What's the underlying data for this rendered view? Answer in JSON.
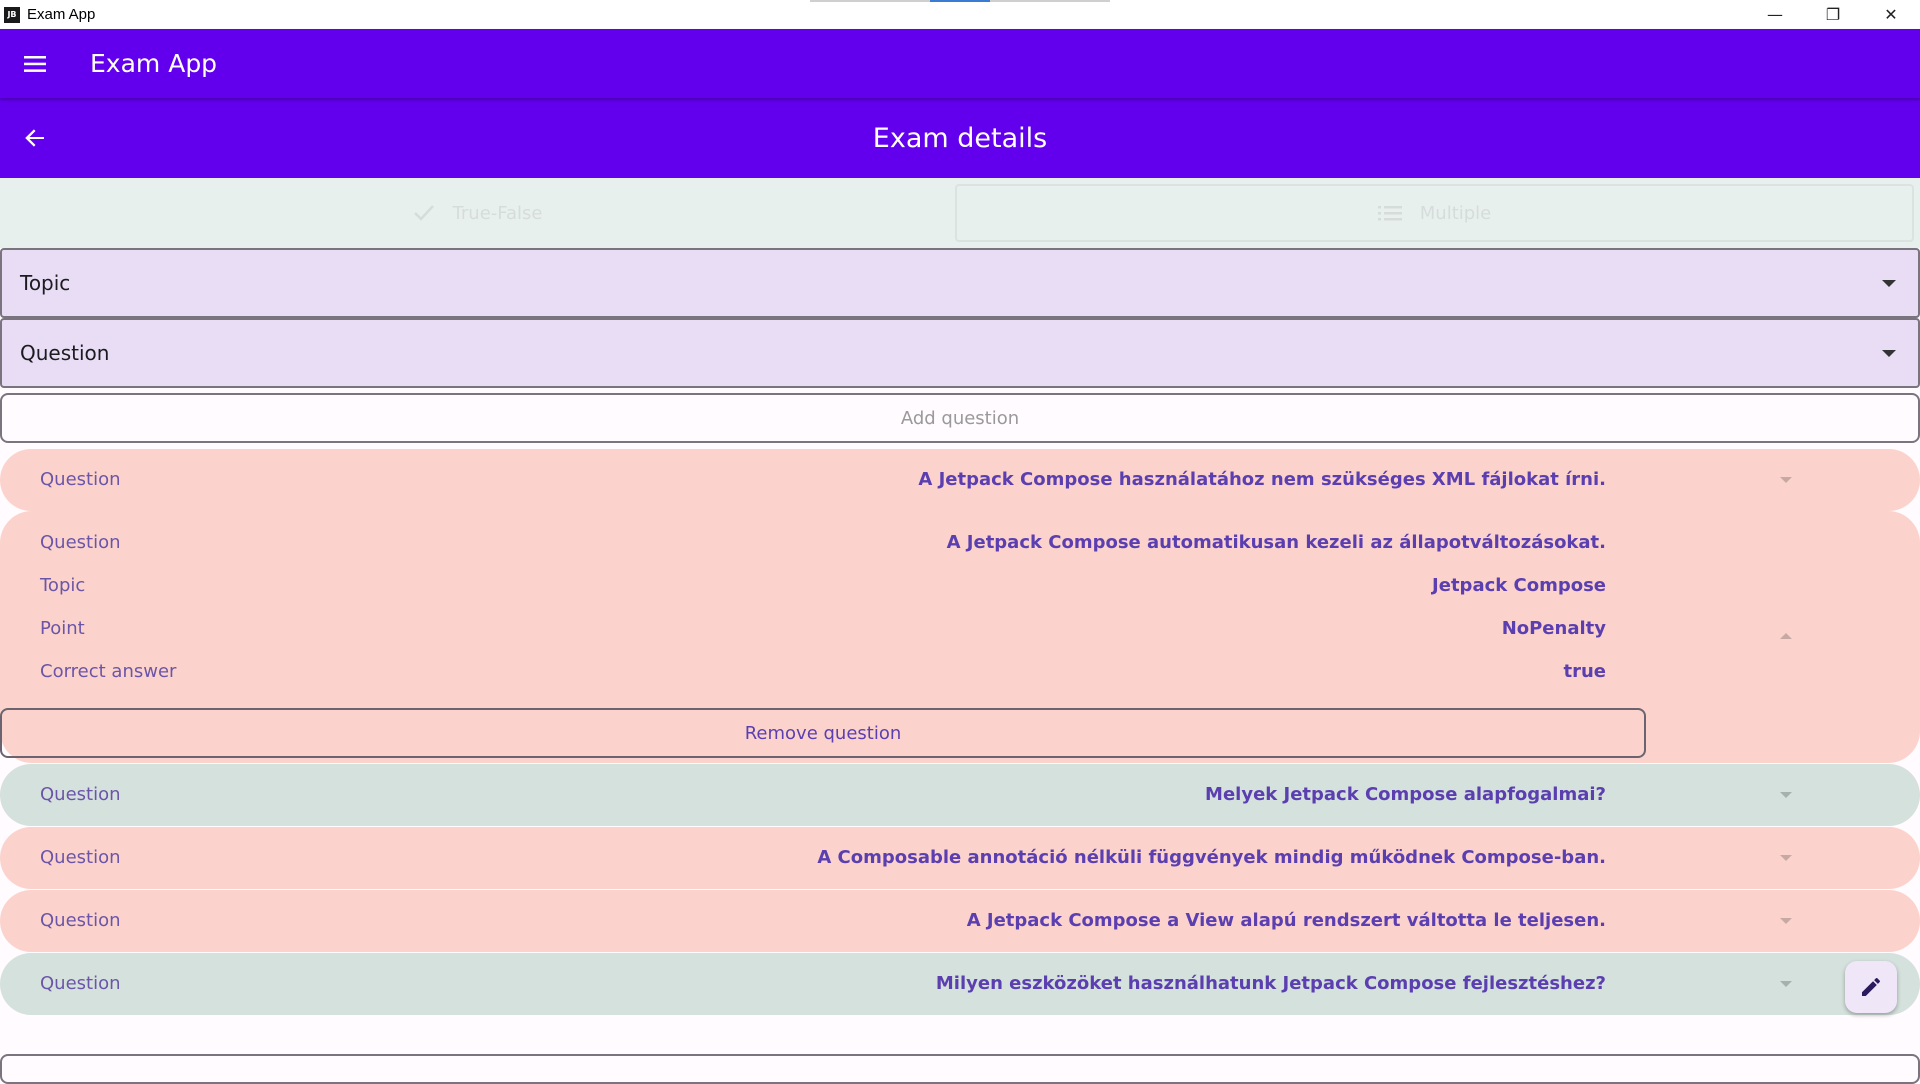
{
  "window": {
    "title": "Exam App",
    "icon_text": "JB",
    "minimize": "—",
    "maximize": "❐",
    "close": "✕"
  },
  "topbar": {
    "title": "Exam App",
    "menu_icon": "menu-icon"
  },
  "subbar": {
    "title": "Exam details",
    "back_icon": "arrow-back-icon"
  },
  "tabs": [
    {
      "label": "True-False",
      "icon": "check-icon",
      "selected": false
    },
    {
      "label": "Multiple",
      "icon": "list-icon",
      "selected": true
    }
  ],
  "dropdowns": {
    "topic": "Topic",
    "question": "Question"
  },
  "add_button": "Add question",
  "remove_button": "Remove question",
  "questions": [
    {
      "label": "Question",
      "text": "A Jetpack Compose használatához nem szükséges XML fájlokat írni.",
      "color": "red",
      "expanded": false
    },
    {
      "label": "Question",
      "text": "A Jetpack Compose automatikusan kezeli az állapotváltozásokat.",
      "color": "red",
      "expanded": true,
      "details": [
        {
          "label": "Topic",
          "value": "Jetpack Compose"
        },
        {
          "label": "Point",
          "value": "NoPenalty"
        },
        {
          "label": "Correct answer",
          "value": "true"
        }
      ]
    },
    {
      "label": "Question",
      "text": "Melyek Jetpack Compose alapfogalmai?",
      "color": "green",
      "expanded": false
    },
    {
      "label": "Question",
      "text": "A Composable annotáció nélküli függvények mindig működnek Compose-ban.",
      "color": "red",
      "expanded": false
    },
    {
      "label": "Question",
      "text": "A Jetpack Compose a View alapú rendszert váltotta le teljesen.",
      "color": "red",
      "expanded": false
    },
    {
      "label": "Question",
      "text": "Milyen eszközöket használhatunk Jetpack Compose fejlesztéshez?",
      "color": "green",
      "expanded": false
    }
  ],
  "colors": {
    "primary": "#6200ee",
    "card_red": "#fbd3cc",
    "card_green": "#d5e1dc",
    "text_accent": "#5b3fb0"
  },
  "fab_icon": "edit-icon"
}
